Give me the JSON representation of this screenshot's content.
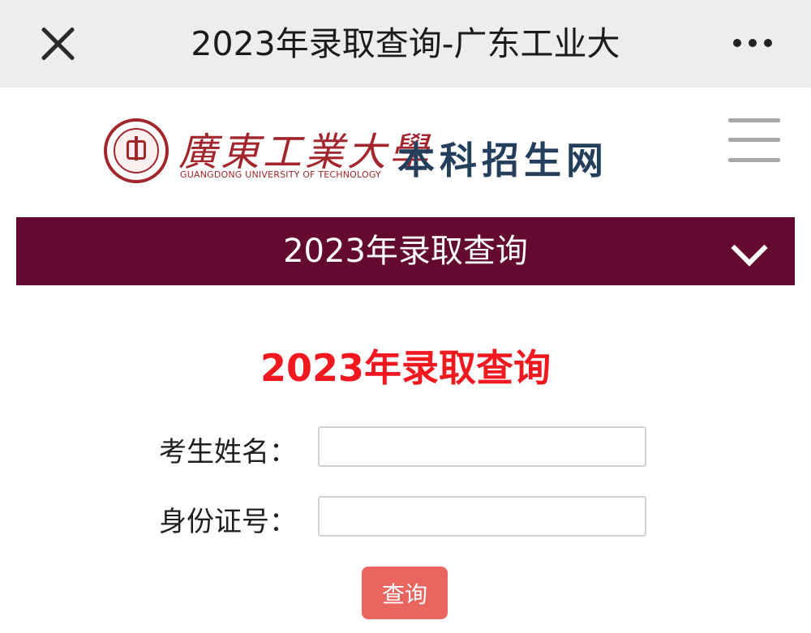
{
  "window": {
    "title": "2023年录取查询-广东工业大",
    "close_icon": "close-icon",
    "more_icon": "more-options-icon"
  },
  "header": {
    "logo_text": "廣東工業大學",
    "logo_subtitle": "GUANGDONG UNIVERSITY OF TECHNOLOGY",
    "site_title": "本科招生网",
    "menu_icon": "hamburger-menu-icon"
  },
  "navbar": {
    "title": "2023年录取查询",
    "expand_icon": "chevron-down-icon"
  },
  "form": {
    "title": "2023年录取查询",
    "name_label": "考生姓名：",
    "name_value": "",
    "id_label": "身份证号：",
    "id_value": "",
    "submit_label": "查询"
  },
  "colors": {
    "topbar_bg": "#ededed",
    "brand_red": "#a3262c",
    "site_title": "#243f5b",
    "navbar_bg": "#640a31",
    "form_title": "#f2181f",
    "button_bg": "#e8665f"
  }
}
